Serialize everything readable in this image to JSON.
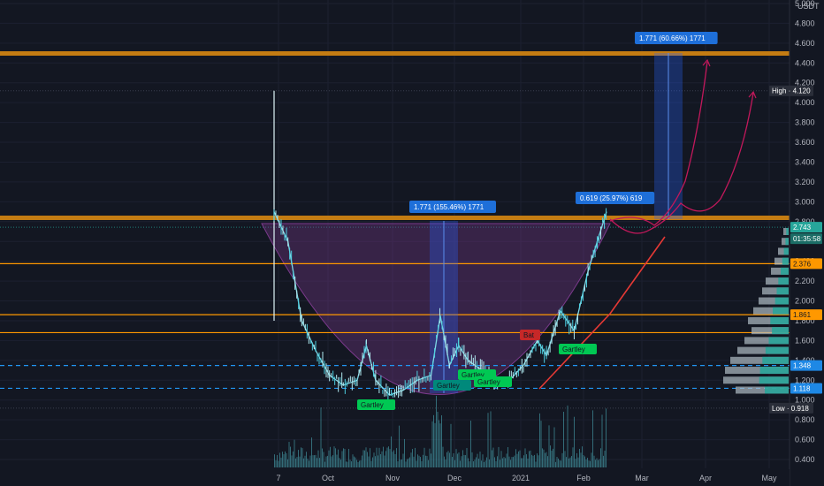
{
  "chart_data": {
    "type": "line",
    "currency": "USDT",
    "y_axis_labels": [
      "5.000",
      "4.800",
      "4.600",
      "4.400",
      "4.200",
      "4.000",
      "3.800",
      "3.600",
      "3.400",
      "3.200",
      "3.000",
      "2.800",
      "2.600",
      "2.400",
      "2.200",
      "2.000",
      "1.800",
      "1.600",
      "1.400",
      "1.200",
      "1.000",
      "0.800",
      "0.600",
      "0.400"
    ],
    "x_axis_labels": [
      "7",
      "Oct",
      "Nov",
      "Dec",
      "2021",
      "Feb",
      "Mar",
      "Apr",
      "May"
    ],
    "price_tags": {
      "high": {
        "label": "High",
        "value": "4.120"
      },
      "low": {
        "label": "Low",
        "value": "0.918"
      },
      "current": {
        "value": "2.743",
        "countdown": "01:35:58"
      },
      "level_2376": "2.376",
      "level_1861": "1.861",
      "level_1348": "1.348",
      "level_1118": "1.118"
    },
    "measurements": [
      {
        "text": "1.771 (155.46%) 1771"
      },
      {
        "text": "0.619 (25.97%) 619"
      },
      {
        "text": "1.771 (60.66%) 1771"
      }
    ],
    "patterns": [
      "Gartley",
      "Gartley",
      "Gartley",
      "Gartley",
      "Bat",
      "Gartley"
    ],
    "horizontal_levels": [
      4.68,
      2.93,
      2.376,
      1.861,
      1.68
    ],
    "dashed_levels": [
      1.348,
      1.118
    ],
    "price_path": [
      [
        0,
        2.9
      ],
      [
        3,
        2.6
      ],
      [
        6,
        1.8
      ],
      [
        9,
        1.5
      ],
      [
        12,
        1.25
      ],
      [
        15,
        1.15
      ],
      [
        18,
        1.2
      ],
      [
        20,
        1.55
      ],
      [
        22,
        1.2
      ],
      [
        25,
        1.05
      ],
      [
        28,
        1.1
      ],
      [
        31,
        1.2
      ],
      [
        34,
        1.25
      ],
      [
        36,
        1.85
      ],
      [
        38,
        1.35
      ],
      [
        40,
        1.55
      ],
      [
        42,
        1.4
      ],
      [
        45,
        1.3
      ],
      [
        48,
        1.2
      ],
      [
        51,
        1.2
      ],
      [
        54,
        1.35
      ],
      [
        57,
        1.6
      ],
      [
        59,
        1.45
      ],
      [
        62,
        1.9
      ],
      [
        65,
        1.7
      ],
      [
        68,
        2.3
      ],
      [
        70,
        2.6
      ],
      [
        72,
        2.9
      ]
    ],
    "colors": {
      "up": "#26a69a",
      "accent": "#2962ff",
      "level": "#ff9800",
      "heavy_level": "#c47c12",
      "cup": "#7b3a8c",
      "projection": "#c2185b",
      "trend": "#e53935",
      "tag_bg": "#1e53b6"
    }
  }
}
